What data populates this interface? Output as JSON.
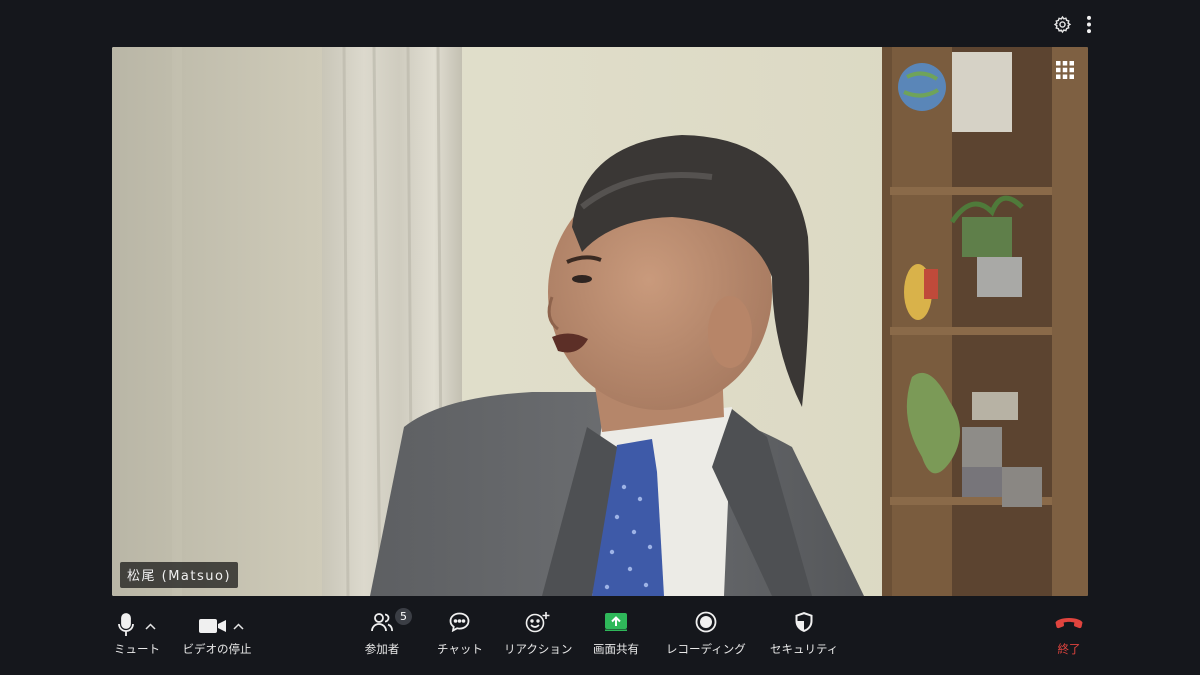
{
  "top": {
    "icons": [
      "gear-icon",
      "more-vertical-icon"
    ]
  },
  "video": {
    "participant_name": "松尾 (Matsuo)",
    "layout_icon": "grid-view-icon"
  },
  "toolbar": {
    "mute": {
      "label": "ミュート",
      "icon": "microphone-icon"
    },
    "video": {
      "label": "ビデオの停止",
      "icon": "video-camera-icon"
    },
    "participants": {
      "label": "参加者",
      "icon": "participants-icon",
      "count": "5"
    },
    "chat": {
      "label": "チャット",
      "icon": "chat-icon"
    },
    "reactions": {
      "label": "リアクション",
      "icon": "smiley-plus-icon"
    },
    "share": {
      "label": "画面共有",
      "icon": "share-screen-icon",
      "color": "#2fb85a"
    },
    "record": {
      "label": "レコーディング",
      "icon": "record-icon"
    },
    "security": {
      "label": "セキュリティ",
      "icon": "shield-icon"
    },
    "end": {
      "label": "終了",
      "icon": "hang-up-icon",
      "color": "#e0443e"
    }
  }
}
